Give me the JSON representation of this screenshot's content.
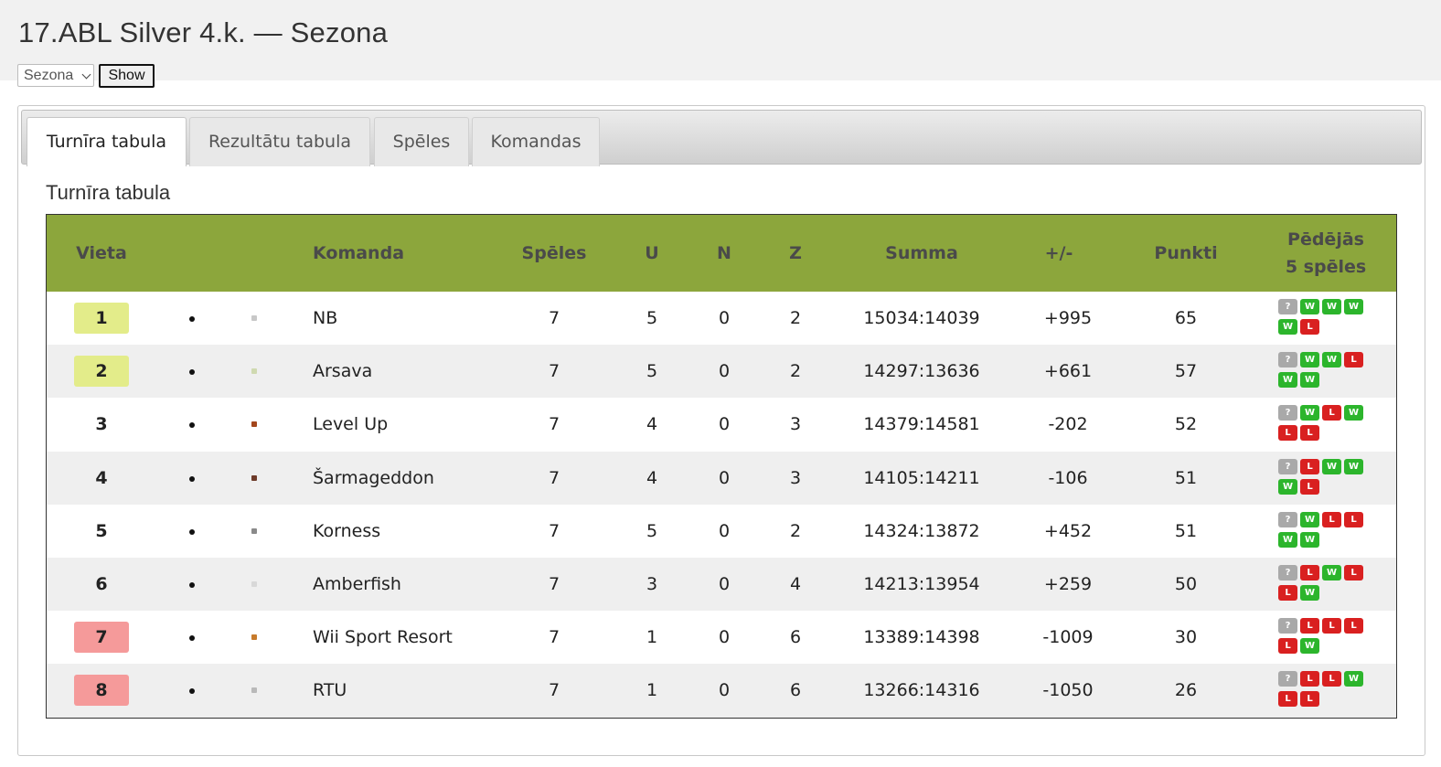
{
  "page": {
    "title": "17.ABL Silver 4.k. — Sezona"
  },
  "season_form": {
    "select_value": "Sezona",
    "show_label": "Show"
  },
  "tabs": [
    {
      "label": "Turnīra tabula",
      "active": true
    },
    {
      "label": "Rezultātu tabula",
      "active": false
    },
    {
      "label": "Spēles",
      "active": false
    },
    {
      "label": "Komandas",
      "active": false
    }
  ],
  "section_title": "Turnīra tabula",
  "colors": {
    "header_bg": "#8ca63c",
    "promotion_badge": "#e3ec8a",
    "relegation_badge": "#f59a9a",
    "win": "#2cb52c",
    "loss": "#d92020",
    "unknown": "#a9a9a9"
  },
  "table": {
    "columns": {
      "place": "Vieta",
      "team": "Komanda",
      "games": "Spēles",
      "wins": "U",
      "draws": "N",
      "losses": "Z",
      "score": "Summa",
      "diff": "+/-",
      "points": "Punkti",
      "last5_line1": "Pēdējās",
      "last5_line2": "5 spēles"
    },
    "rows": [
      {
        "place": "1",
        "zone": "promotion",
        "team": "NB",
        "logo_color": "#c8c8c8",
        "games": "7",
        "wins": "5",
        "draws": "0",
        "losses": "2",
        "score": "15034:14039",
        "diff": "+995",
        "points": "65",
        "form": [
          "?",
          "W",
          "W",
          "W",
          "W",
          "L"
        ]
      },
      {
        "place": "2",
        "zone": "promotion",
        "team": "Arsava",
        "logo_color": "#cfd9b0",
        "games": "7",
        "wins": "5",
        "draws": "0",
        "losses": "2",
        "score": "14297:13636",
        "diff": "+661",
        "points": "57",
        "form": [
          "?",
          "W",
          "W",
          "L",
          "W",
          "W"
        ]
      },
      {
        "place": "3",
        "zone": "none",
        "team": "Level Up",
        "logo_color": "#a3461c",
        "games": "7",
        "wins": "4",
        "draws": "0",
        "losses": "3",
        "score": "14379:14581",
        "diff": "-202",
        "points": "52",
        "form": [
          "?",
          "W",
          "L",
          "W",
          "L",
          "L"
        ]
      },
      {
        "place": "4",
        "zone": "none",
        "team": "Šarmageddon",
        "logo_color": "#6e3b2a",
        "games": "7",
        "wins": "4",
        "draws": "0",
        "losses": "3",
        "score": "14105:14211",
        "diff": "-106",
        "points": "51",
        "form": [
          "?",
          "L",
          "W",
          "W",
          "W",
          "L"
        ]
      },
      {
        "place": "5",
        "zone": "none",
        "team": "Korness",
        "logo_color": "#8a8a8a",
        "games": "7",
        "wins": "5",
        "draws": "0",
        "losses": "2",
        "score": "14324:13872",
        "diff": "+452",
        "points": "51",
        "form": [
          "?",
          "W",
          "L",
          "L",
          "W",
          "W"
        ]
      },
      {
        "place": "6",
        "zone": "none",
        "team": "Amberfish",
        "logo_color": "#d8d8d8",
        "games": "7",
        "wins": "3",
        "draws": "0",
        "losses": "4",
        "score": "14213:13954",
        "diff": "+259",
        "points": "50",
        "form": [
          "?",
          "L",
          "W",
          "L",
          "L",
          "W"
        ]
      },
      {
        "place": "7",
        "zone": "relegation",
        "team": "Wii Sport Resort",
        "logo_color": "#c77b2b",
        "games": "7",
        "wins": "1",
        "draws": "0",
        "losses": "6",
        "score": "13389:14398",
        "diff": "-1009",
        "points": "30",
        "form": [
          "?",
          "L",
          "L",
          "L",
          "L",
          "W"
        ]
      },
      {
        "place": "8",
        "zone": "relegation",
        "team": "RTU",
        "logo_color": "#b9b9b9",
        "games": "7",
        "wins": "1",
        "draws": "0",
        "losses": "6",
        "score": "13266:14316",
        "diff": "-1050",
        "points": "26",
        "form": [
          "?",
          "L",
          "L",
          "W",
          "L",
          "L"
        ]
      }
    ]
  }
}
